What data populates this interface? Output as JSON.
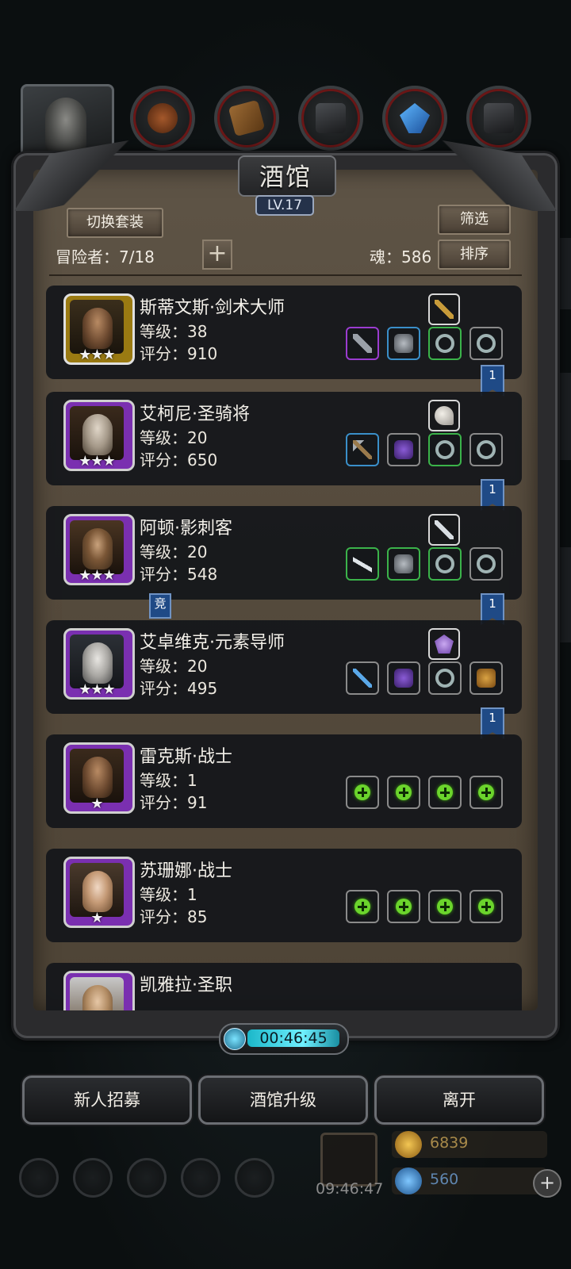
{
  "title": "酒馆",
  "level": "LV.17",
  "buttons": {
    "switch_outfit": "切换套装",
    "filter": "筛选",
    "sort": "排序",
    "add": "+"
  },
  "stats": {
    "adventurers": "冒险者：7/18",
    "soul": "魂：586"
  },
  "heroes": [
    {
      "name": "斯蒂文斯·剑术大师",
      "level": "等级：38",
      "score": "评分：910",
      "stars": "★★★",
      "flag": "1"
    },
    {
      "name": "艾柯尼·圣骑将",
      "level": "等级：20",
      "score": "评分：650",
      "stars": "★★★",
      "flag": "1"
    },
    {
      "name": "阿顿·影刺客",
      "level": "等级：20",
      "score": "评分：548",
      "stars": "★★★",
      "flag": "1",
      "badge": "竞"
    },
    {
      "name": "艾卓维克·元素导师",
      "level": "等级：20",
      "score": "评分：495",
      "stars": "★★★",
      "flag": "1"
    },
    {
      "name": "雷克斯·战士",
      "level": "等级：1",
      "score": "评分：91",
      "stars": "★"
    },
    {
      "name": "苏珊娜·战士",
      "level": "等级：1",
      "score": "评分：85",
      "stars": "★"
    },
    {
      "name": "凯雅拉·圣职"
    }
  ],
  "timer": "00:46:45",
  "bottom_buttons": {
    "recruit": "新人招募",
    "upgrade": "酒馆升级",
    "leave": "离开"
  },
  "resources": {
    "gold": "6839",
    "gems": "560"
  },
  "clock": "09:46:47",
  "colors": {
    "accent_green": "#6bd42c",
    "gold_frame": "#c9a21a",
    "purple_frame": "#8e3cc8",
    "flag_blue": "#1f4a86"
  }
}
